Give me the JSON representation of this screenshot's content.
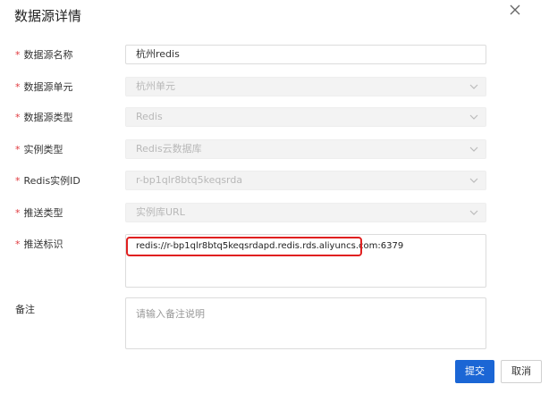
{
  "dialog": {
    "title": "数据源详情",
    "close_icon": "close-icon"
  },
  "form": {
    "name": {
      "label": "数据源名称",
      "required": true,
      "value": "杭州redis"
    },
    "unit": {
      "label": "数据源单元",
      "required": true,
      "value": "杭州单元"
    },
    "type": {
      "label": "数据源类型",
      "required": true,
      "value": "Redis"
    },
    "instance_type": {
      "label": "实例类型",
      "required": true,
      "value": "Redis云数据库"
    },
    "instance_id": {
      "label": "Redis实例ID",
      "required": true,
      "value": "r-bp1qlr8btq5keqsrda"
    },
    "push_type": {
      "label": "推送类型",
      "required": true,
      "value": "实例库URL"
    },
    "push_id": {
      "label": "推送标识",
      "required": true,
      "value": "redis://r-bp1qlr8btq5keqsrdapd.redis.rds.aliyuncs.com:6379"
    },
    "remark": {
      "label": "备注",
      "required": false,
      "placeholder": "请输入备注说明"
    },
    "required_mark": "*"
  },
  "buttons": {
    "submit": "提交",
    "cancel": "取消"
  },
  "colors": {
    "primary": "#1b66d5",
    "required": "#e0393e",
    "highlight": "#e02020"
  }
}
